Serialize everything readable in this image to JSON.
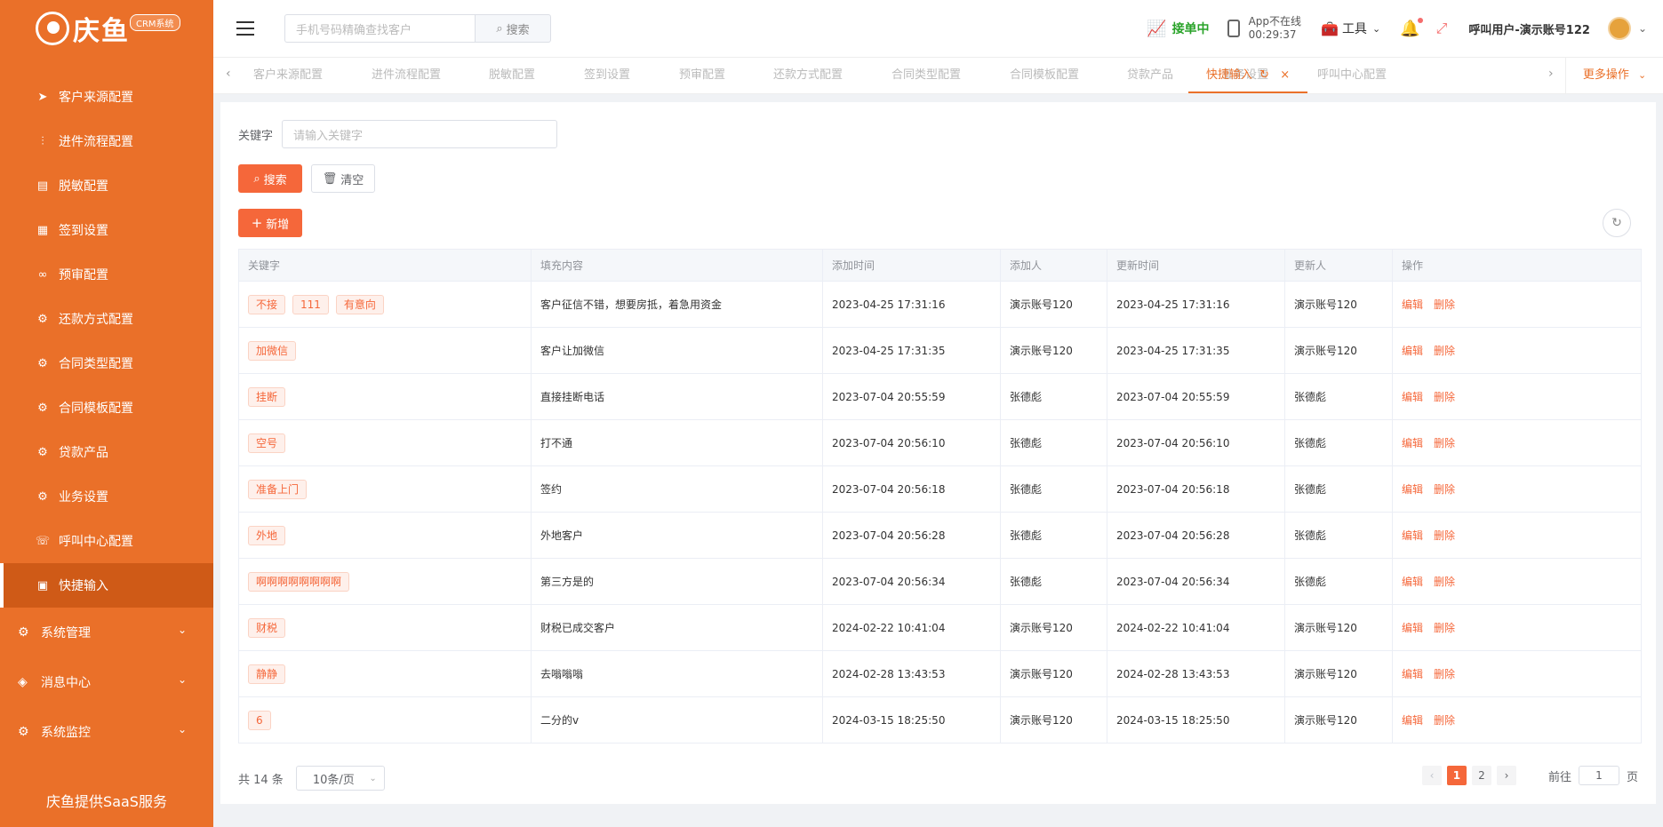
{
  "brand": {
    "name": "庆鱼",
    "badge": "CRM系统",
    "footer": "庆鱼提供SaaS服务"
  },
  "sidebar": {
    "items": [
      {
        "label": "客户来源配置",
        "icon": "send-icon"
      },
      {
        "label": "进件流程配置",
        "icon": "sliders-icon"
      },
      {
        "label": "脱敏配置",
        "icon": "document-icon"
      },
      {
        "label": "签到设置",
        "icon": "calendar-icon"
      },
      {
        "label": "预审配置",
        "icon": "glasses-icon"
      },
      {
        "label": "还款方式配置",
        "icon": "gear-icon"
      },
      {
        "label": "合同类型配置",
        "icon": "gear-icon"
      },
      {
        "label": "合同模板配置",
        "icon": "gear-icon"
      },
      {
        "label": "贷款产品",
        "icon": "gear-icon"
      },
      {
        "label": "业务设置",
        "icon": "gear-icon"
      },
      {
        "label": "呼叫中心配置",
        "icon": "phone-icon"
      },
      {
        "label": "快捷输入",
        "icon": "form-icon",
        "active": true
      }
    ],
    "groups": [
      {
        "label": "系统管理",
        "icon": "gear-icon"
      },
      {
        "label": "消息中心",
        "icon": "diamond-icon"
      },
      {
        "label": "系统监控",
        "icon": "gear-icon"
      }
    ]
  },
  "header": {
    "search_placeholder": "手机号码精确查找客户",
    "search_button": "搜索",
    "accept_status": "接单中",
    "app_status": "App不在线",
    "app_timer": "00:29:37",
    "tools": "工具",
    "user": "呼叫用户-演示账号122"
  },
  "tabs": {
    "items": [
      "客户来源配置",
      "进件流程配置",
      "脱敏配置",
      "签到设置",
      "预审配置",
      "还款方式配置",
      "合同类型配置",
      "合同模板配置",
      "贷款产品",
      "业务设置",
      "呼叫中心配置"
    ],
    "active": "快捷输入",
    "more": "更多操作"
  },
  "filter": {
    "keyword_label": "关键字",
    "keyword_placeholder": "请输入关键字",
    "search_button": "搜索",
    "clear_button": "清空",
    "add_button": "新增"
  },
  "table": {
    "columns": [
      "关键字",
      "填充内容",
      "添加时间",
      "添加人",
      "更新时间",
      "更新人",
      "操作"
    ],
    "edit_label": "编辑",
    "delete_label": "删除",
    "rows": [
      {
        "tags": [
          "不接",
          "111",
          "有意向"
        ],
        "content": "客户征信不错，想要房抵，着急用资金",
        "added": "2023-04-25 17:31:16",
        "adder": "演示账号120",
        "updated": "2023-04-25 17:31:16",
        "updater": "演示账号120"
      },
      {
        "tags": [
          "加微信"
        ],
        "content": "客户让加微信",
        "added": "2023-04-25 17:31:35",
        "adder": "演示账号120",
        "updated": "2023-04-25 17:31:35",
        "updater": "演示账号120"
      },
      {
        "tags": [
          "挂断"
        ],
        "content": "直接挂断电话",
        "added": "2023-07-04 20:55:59",
        "adder": "张德彪",
        "updated": "2023-07-04 20:55:59",
        "updater": "张德彪"
      },
      {
        "tags": [
          "空号"
        ],
        "content": "打不通",
        "added": "2023-07-04 20:56:10",
        "adder": "张德彪",
        "updated": "2023-07-04 20:56:10",
        "updater": "张德彪"
      },
      {
        "tags": [
          "准备上门"
        ],
        "content": "签约",
        "added": "2023-07-04 20:56:18",
        "adder": "张德彪",
        "updated": "2023-07-04 20:56:18",
        "updater": "张德彪"
      },
      {
        "tags": [
          "外地"
        ],
        "content": "外地客户",
        "added": "2023-07-04 20:56:28",
        "adder": "张德彪",
        "updated": "2023-07-04 20:56:28",
        "updater": "张德彪"
      },
      {
        "tags": [
          "啊啊啊啊啊啊啊啊"
        ],
        "content": "第三方是的",
        "added": "2023-07-04 20:56:34",
        "adder": "张德彪",
        "updated": "2023-07-04 20:56:34",
        "updater": "张德彪"
      },
      {
        "tags": [
          "财税"
        ],
        "content": "财税已成交客户",
        "added": "2024-02-22 10:41:04",
        "adder": "演示账号120",
        "updated": "2024-02-22 10:41:04",
        "updater": "演示账号120"
      },
      {
        "tags": [
          "静静"
        ],
        "content": "去嗡嗡嗡",
        "added": "2024-02-28 13:43:53",
        "adder": "演示账号120",
        "updated": "2024-02-28 13:43:53",
        "updater": "演示账号120"
      },
      {
        "tags": [
          "6"
        ],
        "content": "二分的v",
        "added": "2024-03-15 18:25:50",
        "adder": "演示账号120",
        "updated": "2024-03-15 18:25:50",
        "updater": "演示账号120"
      }
    ]
  },
  "pagination": {
    "total": "共 14 条",
    "page_size": "10条/页",
    "pages": [
      "1",
      "2"
    ],
    "current": "1",
    "goto_prefix": "前往",
    "goto_value": "1",
    "goto_suffix": "页"
  }
}
